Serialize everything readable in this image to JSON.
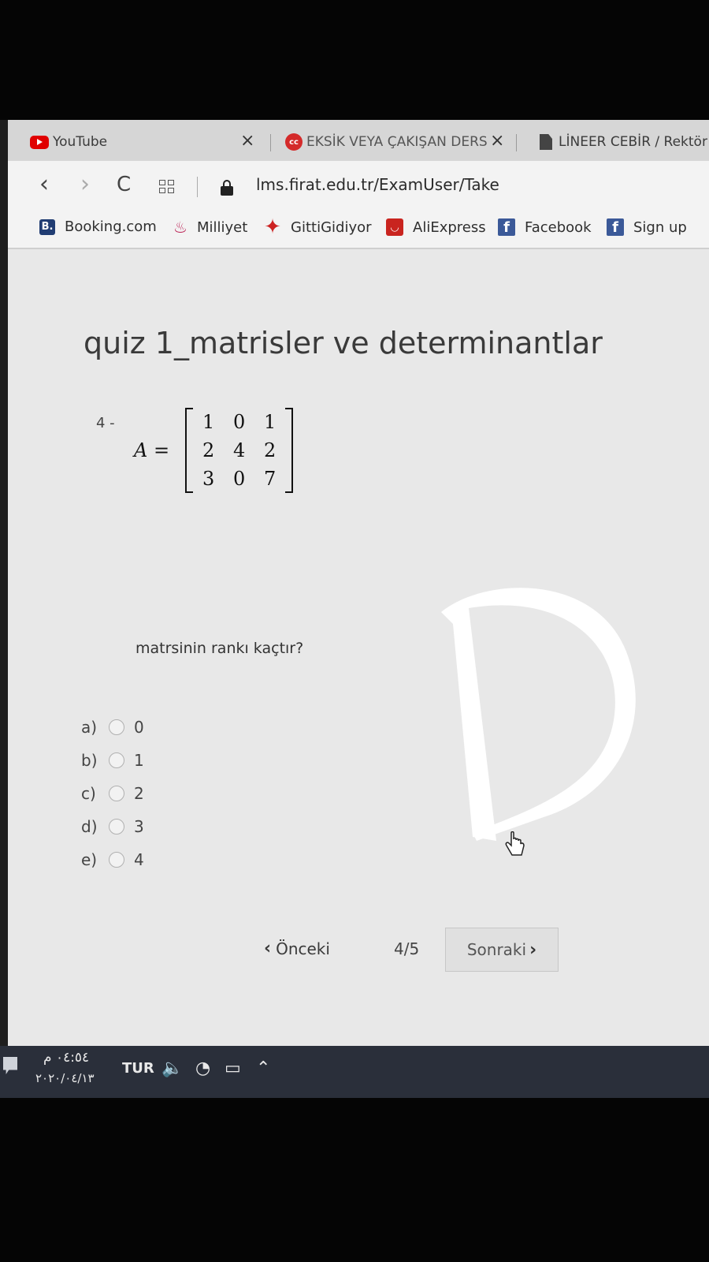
{
  "browser": {
    "tabs": [
      {
        "label": "YouTube",
        "close": "×"
      },
      {
        "label": "EKSİK VEYA ÇAKIŞAN DERS",
        "close": "×"
      },
      {
        "label": "LİNEER CEBİR / Rektör"
      }
    ],
    "url": "lms.firat.edu.tr/ExamUser/Take",
    "nav": {
      "back": "‹",
      "forward": "›",
      "reload": "C"
    },
    "bookmarks": [
      {
        "label": "Booking.com",
        "icon_text": "B.",
        "icon": "booking-icon"
      },
      {
        "label": "Milliyet",
        "icon": "milliyet-icon"
      },
      {
        "label": "GittiGidiyor",
        "icon": "gittigidiyor-icon"
      },
      {
        "label": "AliExpress",
        "icon": "aliexpress-icon"
      },
      {
        "label": "Facebook",
        "icon_text": "f",
        "icon": "facebook-icon"
      },
      {
        "label": "Sign up",
        "icon_text": "f",
        "icon": "facebook-icon"
      }
    ]
  },
  "quiz": {
    "title": "quiz 1_matrisler ve determinantlar",
    "question_number": "4 -",
    "matrix_label": "A =",
    "matrix": [
      [
        "1",
        "0",
        "1"
      ],
      [
        "2",
        "4",
        "2"
      ],
      [
        "3",
        "0",
        "7"
      ]
    ],
    "question_text": "matrsinin rankı kaçtır?",
    "options": [
      {
        "letter": "a)",
        "value": "0"
      },
      {
        "letter": "b)",
        "value": "1"
      },
      {
        "letter": "c)",
        "value": "2"
      },
      {
        "letter": "d)",
        "value": "3"
      },
      {
        "letter": "e)",
        "value": "4"
      }
    ],
    "handwritten_mark": "D"
  },
  "pager": {
    "prev_label": "Önceki",
    "count": "4/5",
    "next_label": "Sonraki"
  },
  "taskbar": {
    "time": "٠٤:٥٤ م",
    "date": "٢٠٢٠/٠٤/١٣",
    "language": "TUR"
  },
  "colors": {
    "youtube_red": "#e00000",
    "facebook_blue": "#3b5998",
    "aliexpress_red": "#c9241f",
    "taskbar": "#2a2f3a"
  }
}
